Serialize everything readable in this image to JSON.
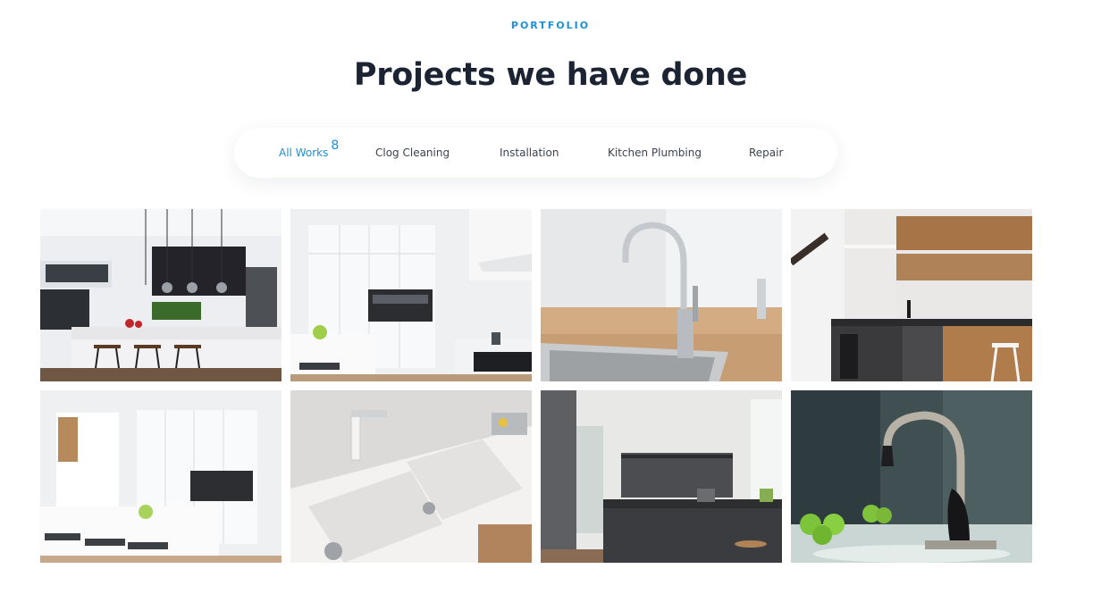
{
  "portfolio": {
    "eyebrow": "PORTFOLIO",
    "title": "Projects we have done"
  },
  "filters": {
    "all": {
      "label": "All Works",
      "count": "8"
    },
    "clog": {
      "label": "Clog Cleaning"
    },
    "installation": {
      "label": "Installation"
    },
    "kitchen": {
      "label": "Kitchen Plumbing"
    },
    "repair": {
      "label": "Repair"
    }
  },
  "colors": {
    "accent": "#1e90d6",
    "heading": "#1c2434",
    "filter_text": "#3c4452"
  },
  "projects": [
    "kitchen-dark-cabinets-photo",
    "white-tall-cabinets-photo",
    "chrome-faucet-photo",
    "wood-shelf-kitchen-photo",
    "white-kitchen-island-photo",
    "white-double-sink-photo",
    "dark-island-kitchen-photo",
    "black-faucet-green-apples-photo"
  ]
}
